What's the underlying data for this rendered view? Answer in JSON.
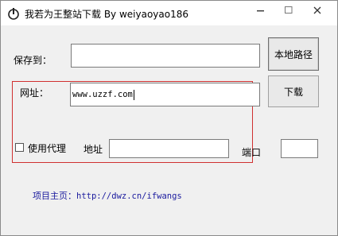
{
  "window": {
    "title": "我若为王整站下载  By weiyaoyao186"
  },
  "form": {
    "save_label": "保存到：",
    "save_value": "",
    "url_label": "网址：",
    "url_value": "www.uzzf.com",
    "proxy_label": "使用代理",
    "proxy_checked": false,
    "address_label": "地址",
    "address_value": "",
    "port_label": "端口",
    "port_value": ""
  },
  "buttons": {
    "local_path": "本地路径",
    "download": "下载"
  },
  "footer": {
    "homepage_label": "项目主页：",
    "homepage_url": "http://dwz.cn/ifwangs"
  },
  "colors": {
    "highlight_box": "#d03030",
    "link": "#1a1a9e"
  }
}
